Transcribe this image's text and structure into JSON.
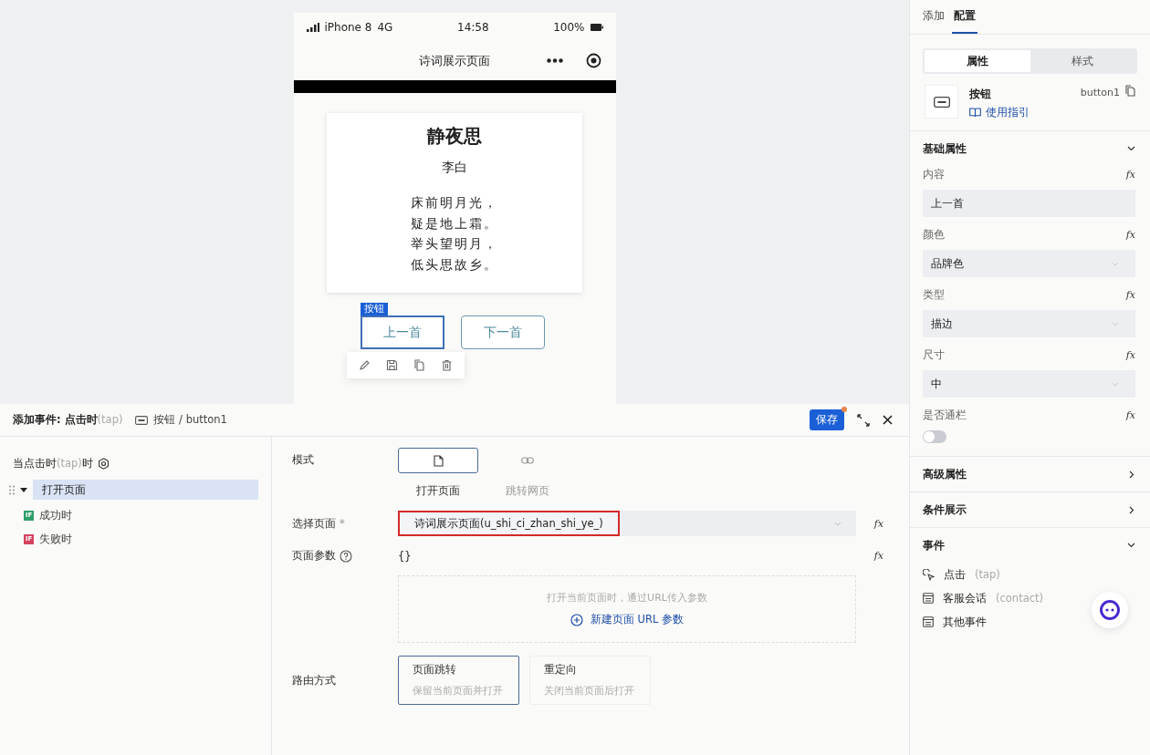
{
  "phone": {
    "status": {
      "carrier": "iPhone 8",
      "network": "4G",
      "time": "14:58",
      "battery": "100%"
    },
    "nav_title": "诗词展示页面",
    "card": {
      "title": "静夜思",
      "author": "李白",
      "lines": [
        "床前明月光，",
        "疑是地上霜。",
        "举头望明月，",
        "低头思故乡。"
      ]
    },
    "selection_tag": "按钮",
    "buttons": [
      {
        "label": "上一首",
        "selected": true
      },
      {
        "label": "下一首",
        "selected": false
      }
    ]
  },
  "event_panel": {
    "title": "添加事件: 点击时",
    "title_hint": "(tap)",
    "component": "按钮 / button1",
    "save": "保存",
    "trigger": {
      "prefix": "当点击时",
      "hint": "(tap)",
      "suffix": "时"
    },
    "actions": [
      {
        "label": "打开页面",
        "selected": true,
        "expanded": true,
        "children": [
          {
            "badge": "IF",
            "label": "成功时",
            "color": "#2f9e6b"
          },
          {
            "badge": "IF",
            "label": "失败时",
            "color": "#d4445f"
          }
        ]
      }
    ],
    "form": {
      "mode_label": "模式",
      "modes": [
        {
          "label": "打开页面",
          "kind": "page",
          "selected": true
        },
        {
          "label": "跳转网页",
          "kind": "link",
          "selected": false
        }
      ],
      "page_label": "选择页面",
      "required": "*",
      "page_value": "诗词展示页面(u_shi_ci_zhan_shi_ye_)",
      "fx": "fx",
      "params_label": "页面参数",
      "params_value": "{}",
      "params_fx": "fx",
      "params_hint": "打开当前页面时，通过URL传入参数",
      "params_add": "新建页面 URL 参数",
      "route_label": "路由方式",
      "routes": [
        {
          "title": "页面跳转",
          "desc": "保留当前页面并打开",
          "selected": true
        },
        {
          "title": "重定向",
          "desc": "关闭当前页面后打开",
          "selected": false
        }
      ]
    }
  },
  "right_panel": {
    "tabs": [
      {
        "label": "添加",
        "selected": false
      },
      {
        "label": "配置",
        "selected": true
      }
    ],
    "segments": [
      {
        "label": "属性",
        "selected": true
      },
      {
        "label": "样式",
        "selected": false
      }
    ],
    "component": {
      "name": "按钮",
      "guide": "使用指引",
      "id": "button1"
    },
    "basic": {
      "title": "基础属性",
      "expanded": true,
      "props": [
        {
          "label": "内容",
          "fx": "fx",
          "kind": "input",
          "value": "上一首"
        },
        {
          "label": "颜色",
          "fx": "fx",
          "kind": "select",
          "value": "品牌色"
        },
        {
          "label": "类型",
          "fx": "fx",
          "kind": "select",
          "value": "描边"
        },
        {
          "label": "尺寸",
          "fx": "fx",
          "kind": "select",
          "value": "中"
        },
        {
          "label": "是否通栏",
          "fx": "fx",
          "kind": "switch",
          "on": false
        }
      ]
    },
    "sections": [
      {
        "title": "高级属性",
        "expanded": false
      },
      {
        "title": "条件展示",
        "expanded": false
      }
    ],
    "events": {
      "title": "事件",
      "expanded": true,
      "items": [
        {
          "label": "点击",
          "hint": "(tap)",
          "kind": "tap"
        },
        {
          "label": "客服会话",
          "hint": "(contact)",
          "kind": "form"
        },
        {
          "label": "其他事件",
          "kind": "form"
        }
      ]
    }
  }
}
